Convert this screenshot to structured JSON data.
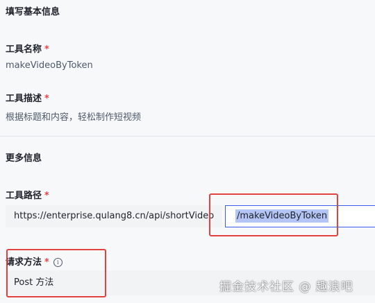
{
  "basic": {
    "title": "填写基本信息",
    "tool_name_label": "工具名称",
    "tool_name_value": "makeVideoByToken",
    "tool_desc_label": "工具描述",
    "tool_desc_value": "根据标题和内容，轻松制作短视频",
    "required_mark": "*"
  },
  "more": {
    "title": "更多信息",
    "path_label": "工具路径",
    "path_prefix": "https://enterprise.qulang8.cn/api/shortVideo",
    "path_value": "/makeVideoByToken",
    "method_label": "请求方法",
    "method_value": "Post 方法",
    "info_icon": "i"
  },
  "watermark": "掘金技术社区 @ 趣浪吧",
  "colors": {
    "required": "#f53f3f",
    "input_border": "#3a5af0",
    "highlight_box": "#e34040",
    "selection": "#b4c5f5"
  }
}
